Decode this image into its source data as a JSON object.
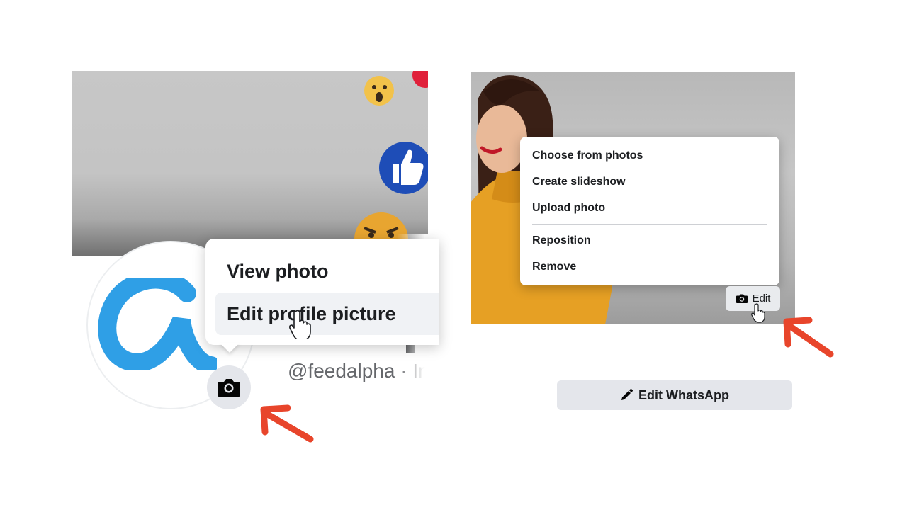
{
  "profile_menu": {
    "view_photo": "View photo",
    "edit_profile_picture": "Edit profile picture"
  },
  "profile": {
    "handle": "@feedalpha · In"
  },
  "cover_menu": {
    "choose_from_photos": "Choose from photos",
    "create_slideshow": "Create slideshow",
    "upload_photo": "Upload photo",
    "reposition": "Reposition",
    "remove": "Remove"
  },
  "cover_edit_button": "Edit",
  "edit_whatsapp_button": "Edit WhatsApp",
  "icons": [
    "camera-icon",
    "pencil-icon",
    "hand-cursor-icon",
    "arrow-icon"
  ],
  "colors": {
    "annotation_arrow": "#e8452b",
    "logo_blue": "#2f9fe6",
    "menu_hover": "#f0f2f5",
    "button_gray": "#e4e6eb"
  }
}
